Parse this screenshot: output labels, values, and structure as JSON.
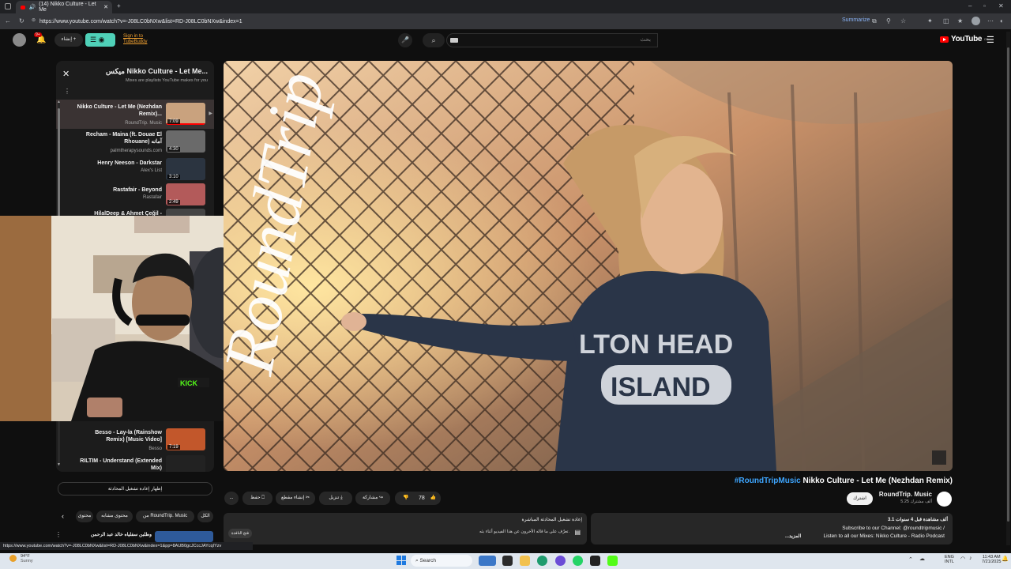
{
  "browser": {
    "tab_title": "(14) Nikko Culture - Let Me",
    "url": "https://www.youtube.com/watch?v=-J08LC0bNXw&list=RD-J08LC0bNXw&index=1",
    "summarize": "Summarize"
  },
  "header": {
    "logo": "YouTube",
    "logo_badge": "DE",
    "search_placeholder": "بحث",
    "create_label": "إنشاء",
    "notif_count": "9+",
    "signin_line1": "Sign in to",
    "signin_line2": "TubeBuddy"
  },
  "playlist": {
    "title": "ميكس Nikko Culture - Let Me...",
    "subtitle": "Mixes are playlists YouTube makes for you",
    "items": [
      {
        "title": "Nikko Culture - Let Me (Nezhdan Remix)...",
        "channel": "RoundTrip. Music",
        "duration": "7:09",
        "color": "#c9a27e"
      },
      {
        "title": "Recham - Maina (ft. Douae El Rhouane) آمانه",
        "channel": "palmtherapysounds.com",
        "duration": "4:30",
        "color": "#6a6a6a"
      },
      {
        "title": "Henry Neeson - Darkstar",
        "channel": "Alex's List",
        "duration": "3:10",
        "color": "#2b3440"
      },
      {
        "title": "Rastafair - Beyond",
        "channel": "Rastafair",
        "duration": "2:49",
        "color": "#b35a5a"
      },
      {
        "title": "HilalDeep & Ahmet Çeğil -",
        "channel": "",
        "duration": "",
        "color": "#444"
      },
      {
        "title": "Besso - Lay-la (Rainshow Remix) [Music Video]",
        "channel": "Besso",
        "duration": "7:19",
        "color": "#c2572b"
      },
      {
        "title": "RILTIM - Understand (Extended Mix)",
        "channel": "",
        "duration": "",
        "color": "#222"
      }
    ],
    "chat_replay": "إظهار إعادة تشغيل المحادثة"
  },
  "video": {
    "title": "Nikko Culture - Let Me (Nezhdan Remix)",
    "hashtag": "#RoundTripMusic",
    "channel": "RoundTrip. Music",
    "subscribers": "5.25 ألف مشترك",
    "subscribe": "اشترك",
    "likes": "78",
    "share": "مشاركة",
    "download": "تنزيل",
    "clip": "إنشاء مقطع",
    "save": "حفظ",
    "more": "..."
  },
  "chips": {
    "all": "الكل",
    "from": "من RoundTrip. Music",
    "similar": "محتوى مشابه",
    "watched": "محتوى"
  },
  "description": {
    "views": "3.1 ألف مشاهدة قبل 4 سنوات",
    "line1": "Subscribe to our Channel: @roundtripmusic /",
    "line2": "Listen to all our Mixes: Nikko Culture - Radio Podcast",
    "more": "...المزيد"
  },
  "chat": {
    "title": "إعادة تشغيل المحادثة المباشرة",
    "text": "تعرّف على ما قاله الآخرون عن هذا الفيديو أثناء بثه.",
    "button": "فتح النافذة"
  },
  "bottom_item": {
    "title": "وطلبن سفلياه خالد عبد الرحمن"
  },
  "status_url": "https://www.youtube.com/watch?v=-J08LC0bNXw&list=RD-J08LC0bNXw&index=1&pp=8AUB0gcJCccJAYcqIYzv",
  "taskbar": {
    "weather_temp": "94°F",
    "weather_desc": "Sunny",
    "search": "Search",
    "lang": "ENG",
    "lang2": "INTL",
    "time": "11:43 AM",
    "date": "7/21/2025"
  },
  "watermark": "RoundTrip"
}
